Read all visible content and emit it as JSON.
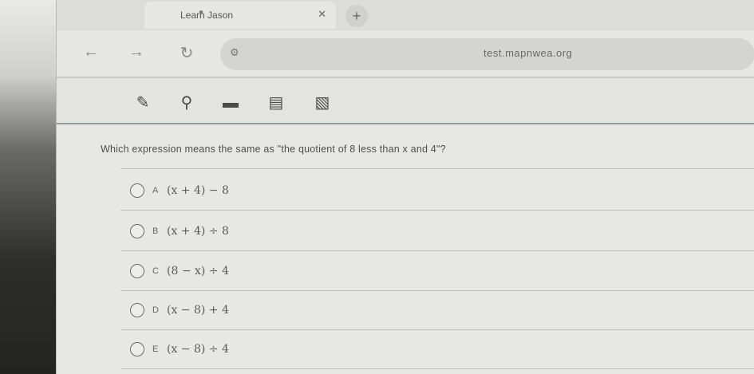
{
  "browser": {
    "tab_title": "Learn Jason",
    "tab_close": "✕",
    "new_tab": "+",
    "url": "test.mapnwea.org"
  },
  "toolbar": {
    "tools": [
      "pencil-icon",
      "magnifier-icon",
      "line-reader-icon",
      "notepad-icon",
      "calculator-icon"
    ]
  },
  "question": {
    "text": "Which expression means the same as \"the quotient of 8 less than x and 4\"?",
    "choices": [
      {
        "letter": "A",
        "expr": "(x + 4) − 8"
      },
      {
        "letter": "B",
        "expr": "(x + 4) ÷ 8"
      },
      {
        "letter": "C",
        "expr": "(8 − x) ÷ 4"
      },
      {
        "letter": "D",
        "expr": "(x − 8) + 4"
      },
      {
        "letter": "E",
        "expr": "(x − 8) ÷ 4"
      }
    ]
  }
}
